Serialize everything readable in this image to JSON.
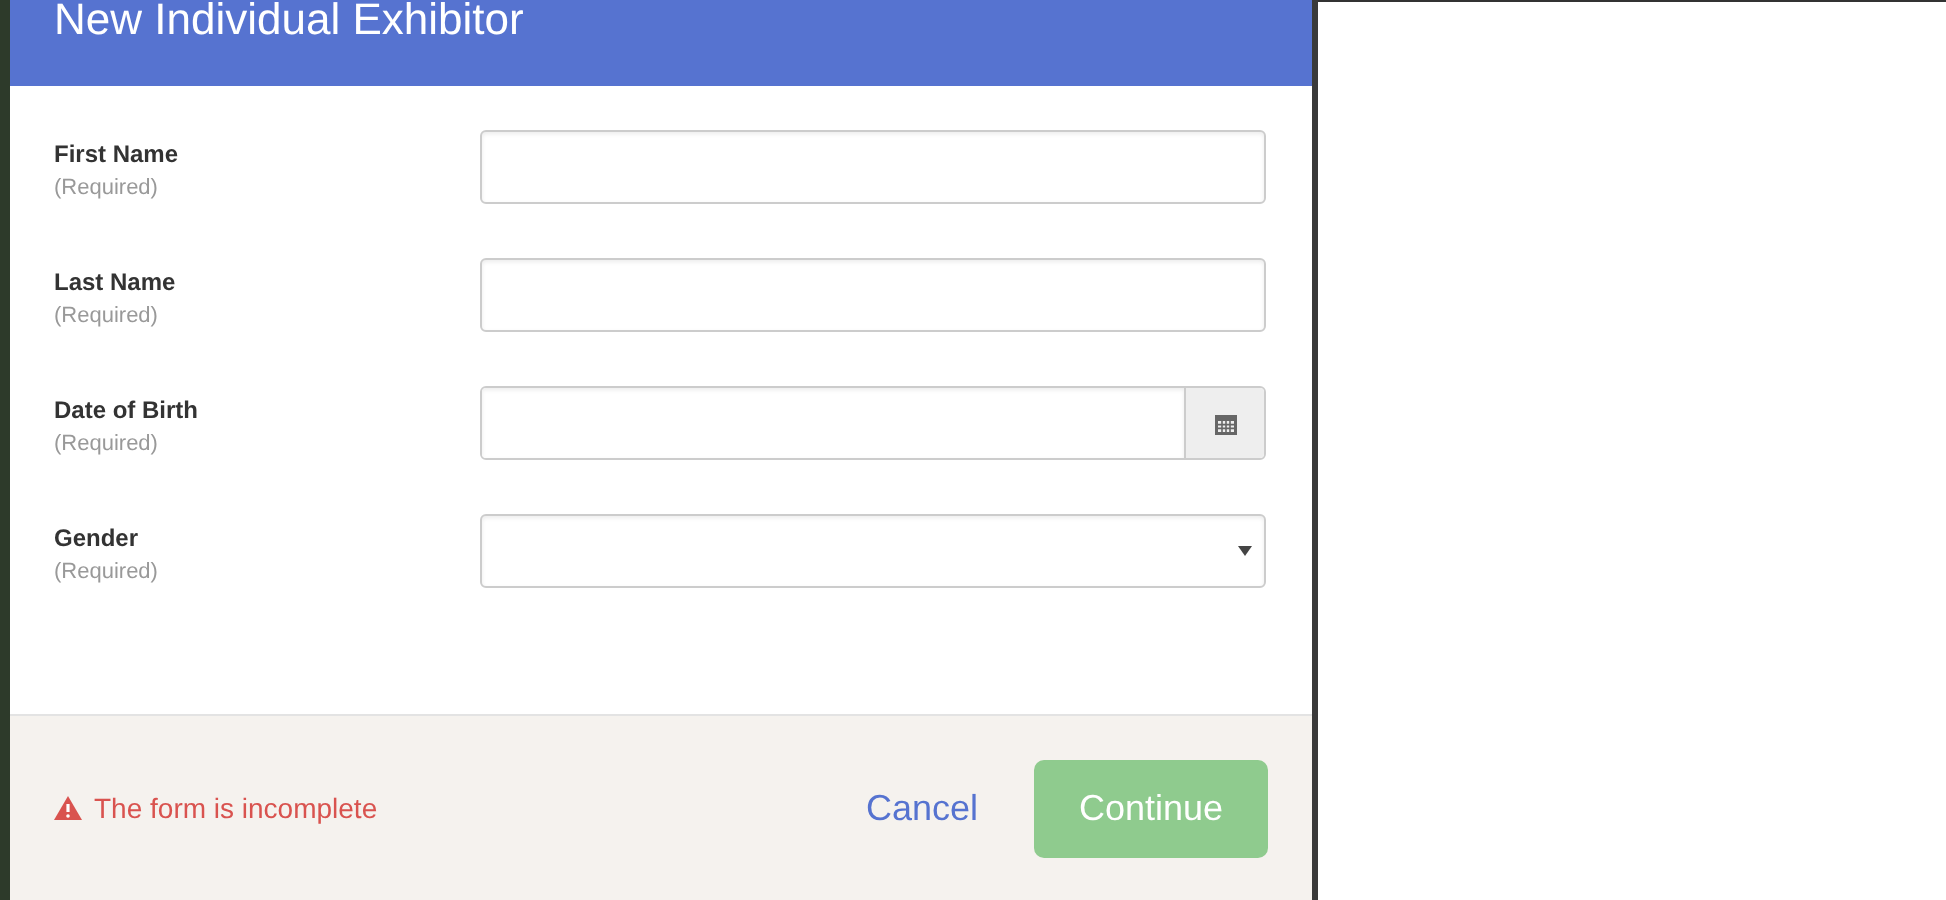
{
  "dialog": {
    "title": "New Individual Exhibitor"
  },
  "fields": [
    {
      "label": "First Name",
      "hint": "(Required)",
      "kind": "text"
    },
    {
      "label": "Last Name",
      "hint": "(Required)",
      "kind": "text"
    },
    {
      "label": "Date of Birth",
      "hint": "(Required)",
      "kind": "date"
    },
    {
      "label": "Gender",
      "hint": "(Required)",
      "kind": "select"
    }
  ],
  "footer": {
    "warning": "The form is incomplete",
    "cancel": "Cancel",
    "continue": {
      "label": "Continue",
      "disabled": true
    }
  }
}
